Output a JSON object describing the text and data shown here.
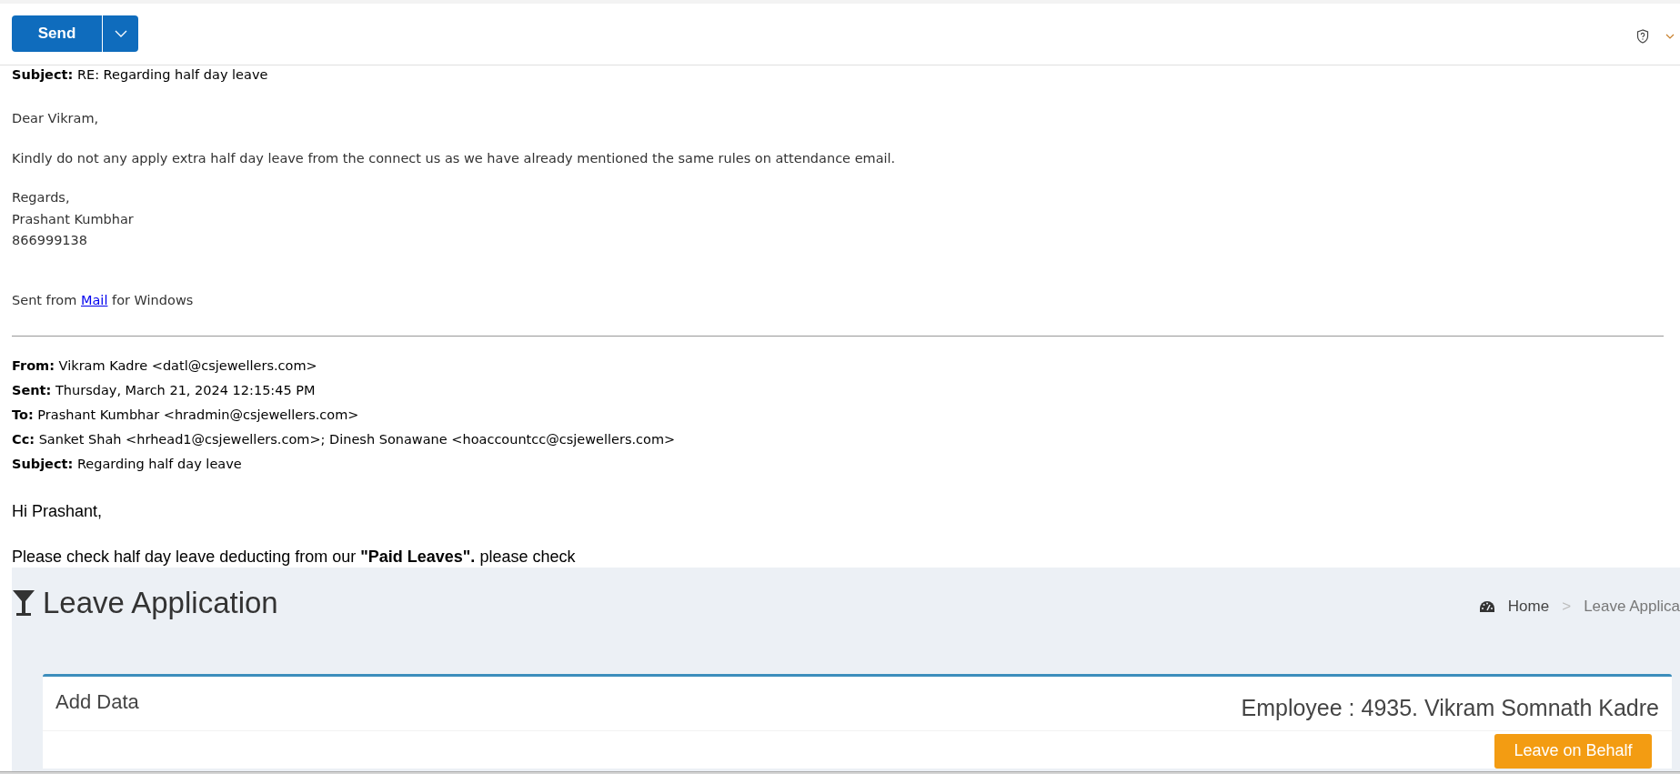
{
  "toolbar": {
    "send_button": "Send"
  },
  "reply": {
    "subject": "**Subject:** RE: Regarding half day leave",
    "greeting": "Dear Vikram,",
    "message": "Kindly do not any apply extra half day leave from the connect us as we have already mentioned the same rules on attendance email.",
    "signature": [
      "Regards,",
      "Prashant Kumbhar",
      "866999138"
    ],
    "sent_from": {
      "before": "Sent from",
      "link": "Mail",
      "after": "for Windows"
    }
  },
  "original_message": {
    "headers": [
      "**From:** Vikram Kadre <datl@csjewellers.com>",
      "**Sent:** Thursday, March 21, 2024 12:15:45 PM",
      "**To:** Prashant Kumbhar <hradmin@csjewellers.com>",
      "**Cc:** Sanket Shah <hrhead1@csjewellers.com>; Dinesh Sonawane <hoaccountcc@csjewellers.com>",
      "**Subject:** Regarding half day leave"
    ],
    "greeting": "Hi Prashant,",
    "message": "Please check half day leave deducting from our **\"Paid Leaves\".** please check"
  },
  "embedded_screenshot": {
    "title": "Leave Application",
    "breadcrumb": {
      "home": "Home",
      "separator": ">",
      "current": "Leave Applica"
    },
    "card": {
      "title": "Add Data",
      "employee": "Employee : 4935. Vikram Somnath Kadre",
      "button": "Leave on Behalf"
    }
  }
}
